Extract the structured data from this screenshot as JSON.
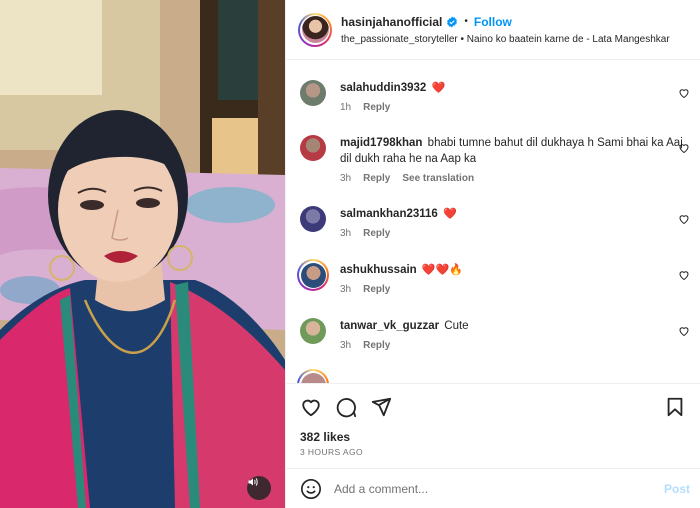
{
  "post": {
    "username": "hasinjahanofficial",
    "follow_label": "Follow",
    "audio_line": "the_passionate_storyteller • Naino ko baatein karne de - Lata Mangeshkar"
  },
  "comments": [
    {
      "user": "salahuddin3932",
      "text": "❤️",
      "time": "1h",
      "reply": "Reply"
    },
    {
      "user": "majid1798khan",
      "text": "bhabi tumne bahut dil dukhaya h Sami bhai ka Aaj dil dukh raha he na Aap ka",
      "time": "3h",
      "reply": "Reply",
      "translate": "See translation"
    },
    {
      "user": "salmankhan23116",
      "text": "❤️",
      "time": "3h",
      "reply": "Reply"
    },
    {
      "user": "ashukhussain",
      "text": "❤️❤️🔥",
      "time": "3h",
      "reply": "Reply"
    },
    {
      "user": "tanwar_vk_guzzar",
      "text": "Cute",
      "time": "3h",
      "reply": "Reply"
    }
  ],
  "likes": "382 likes",
  "time_ago": "3 HOURS AGO",
  "comment_box": {
    "placeholder": "Add a comment...",
    "post_label": "Post"
  },
  "icons": {
    "like": "heart-icon",
    "comment": "comment-icon",
    "share": "share-icon",
    "save": "bookmark-icon",
    "emoji": "emoji-icon",
    "sound": "sound-icon",
    "verified": "verified-icon"
  },
  "colors": {
    "accent": "#0095f6",
    "heart": "#ed4956",
    "muted": "#737373",
    "post_disabled": "#b2dffc"
  }
}
